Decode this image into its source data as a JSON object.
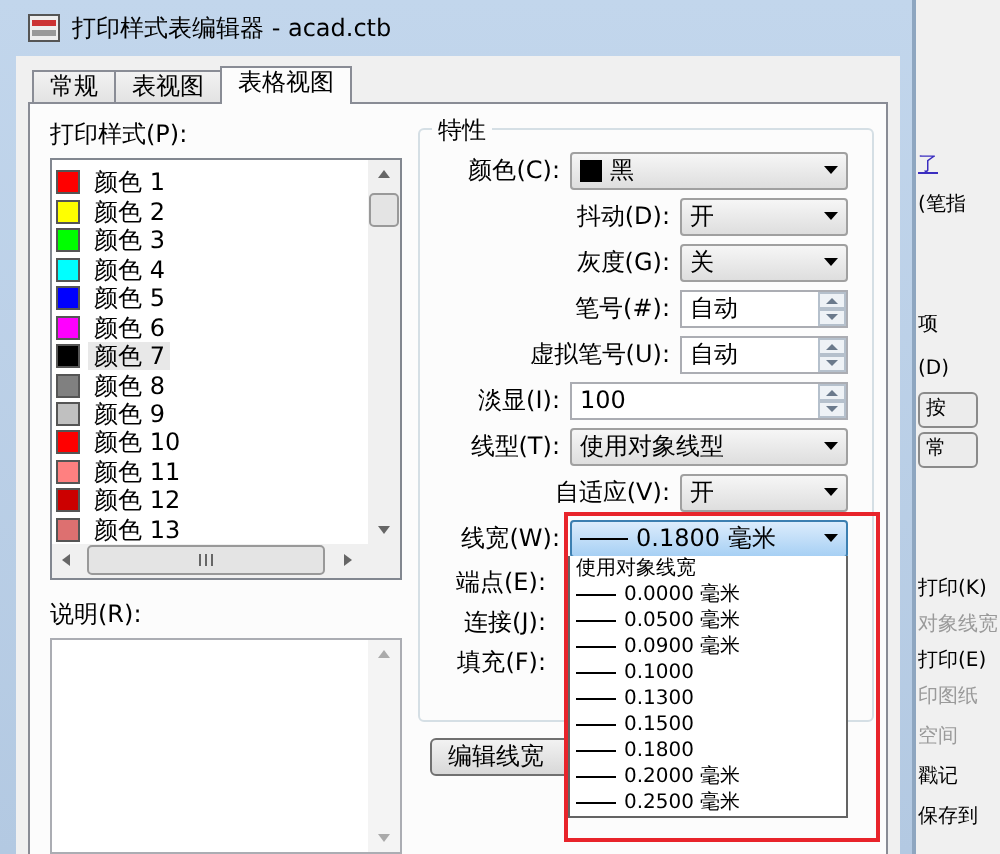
{
  "window": {
    "title": "打印样式表编辑器 - acad.ctb"
  },
  "tabs": [
    {
      "label": "常规",
      "selected": false
    },
    {
      "label": "表视图",
      "selected": false
    },
    {
      "label": "表格视图",
      "selected": true
    }
  ],
  "styles_list": {
    "label": "打印样式(P):",
    "items": [
      {
        "label": "颜色 1",
        "color": "#ff0000",
        "selected": false
      },
      {
        "label": "颜色 2",
        "color": "#ffff00",
        "selected": false
      },
      {
        "label": "颜色 3",
        "color": "#00ff00",
        "selected": false
      },
      {
        "label": "颜色 4",
        "color": "#00ffff",
        "selected": false
      },
      {
        "label": "颜色 5",
        "color": "#0000ff",
        "selected": false
      },
      {
        "label": "颜色 6",
        "color": "#ff00ff",
        "selected": false
      },
      {
        "label": "颜色 7",
        "color": "#000000",
        "selected": true
      },
      {
        "label": "颜色 8",
        "color": "#808080",
        "selected": false
      },
      {
        "label": "颜色 9",
        "color": "#c0c0c0",
        "selected": false
      },
      {
        "label": "颜色 10",
        "color": "#ff0000",
        "selected": false
      },
      {
        "label": "颜色 11",
        "color": "#ff8080",
        "selected": false
      },
      {
        "label": "颜色 12",
        "color": "#cc0000",
        "selected": false
      },
      {
        "label": "颜色 13",
        "color": "#dd7070",
        "selected": false
      }
    ]
  },
  "description": {
    "label": "说明(R):"
  },
  "properties": {
    "title": "特性",
    "fields": [
      {
        "label": "颜色(C):",
        "kind": "swatch-select",
        "value": "黑",
        "color": "#000000"
      },
      {
        "label": "抖动(D):",
        "kind": "select",
        "value": "开"
      },
      {
        "label": "灰度(G):",
        "kind": "select",
        "value": "关"
      },
      {
        "label": "笔号(#):",
        "kind": "spin",
        "value": "自动"
      },
      {
        "label": "虚拟笔号(U):",
        "kind": "spin",
        "value": "自动"
      },
      {
        "label": "淡显(I):",
        "kind": "spin-wide",
        "value": "100"
      },
      {
        "label": "线型(T):",
        "kind": "select-wide",
        "value": "使用对象线型"
      },
      {
        "label": "自适应(V):",
        "kind": "select",
        "value": "开"
      },
      {
        "label": "线宽(W):",
        "kind": "line-select",
        "value": "0.1800 毫米",
        "focused": true
      },
      {
        "label": "端点(E):",
        "kind": "label"
      },
      {
        "label": "连接(J):",
        "kind": "label"
      },
      {
        "label": "填充(F):",
        "kind": "label"
      }
    ]
  },
  "edit_button": "编辑线宽",
  "lineweight_dropdown": {
    "items": [
      {
        "kind": "text",
        "label": "使用对象线宽"
      },
      {
        "kind": "line",
        "label": "0.0000 毫米"
      },
      {
        "kind": "line",
        "label": "0.0500 毫米"
      },
      {
        "kind": "line",
        "label": "0.0900 毫米"
      },
      {
        "kind": "line",
        "label": "0.1000"
      },
      {
        "kind": "line",
        "label": "0.1300"
      },
      {
        "kind": "line",
        "label": "0.1500"
      },
      {
        "kind": "line",
        "label": "0.1800"
      },
      {
        "kind": "line",
        "label": "0.2000 毫米"
      },
      {
        "kind": "line",
        "label": "0.2500 毫米"
      }
    ]
  },
  "highlight_frame": true,
  "background_window": {
    "items": [
      {
        "kind": "link",
        "label": "了"
      },
      {
        "kind": "text",
        "label": "(笔指"
      },
      {
        "kind": "text",
        "label": "项"
      },
      {
        "kind": "text",
        "label": "(D)"
      },
      {
        "kind": "button",
        "label": "按"
      },
      {
        "kind": "button",
        "label": "常"
      },
      {
        "kind": "text",
        "label": "打印(K)"
      },
      {
        "kind": "muted",
        "label": "对象线宽"
      },
      {
        "kind": "text",
        "label": "打印(E)"
      },
      {
        "kind": "muted",
        "label": "印图纸"
      },
      {
        "kind": "muted",
        "label": "空间"
      },
      {
        "kind": "text",
        "label": "戳记"
      },
      {
        "kind": "text",
        "label": "保存到"
      }
    ]
  }
}
